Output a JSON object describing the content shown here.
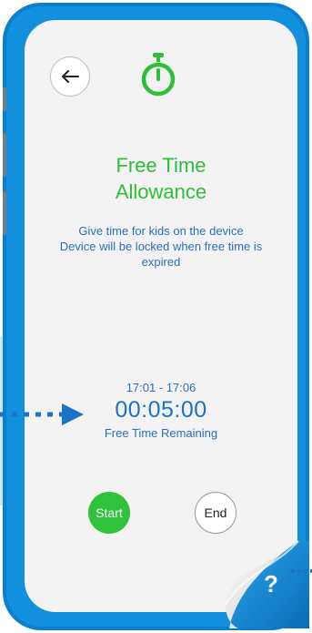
{
  "header": {
    "back_icon": "arrow-left-icon",
    "timer_icon": "stopwatch-icon"
  },
  "title": {
    "line1": "Free Time",
    "line2": "Allowance"
  },
  "description": {
    "line1": "Give time for kids on the device",
    "line2": "Device will be locked when free time is",
    "line3": "expired"
  },
  "timer": {
    "range": "17:01 - 17:06",
    "countdown": "00:05:00",
    "caption": "Free Time Remaining"
  },
  "actions": {
    "start_label": "Start",
    "end_label": "End"
  },
  "help": {
    "label": "?"
  },
  "colors": {
    "frame": "#0a7fce",
    "accent_green": "#2dbf3a",
    "text_blue": "#2a6fbd"
  }
}
